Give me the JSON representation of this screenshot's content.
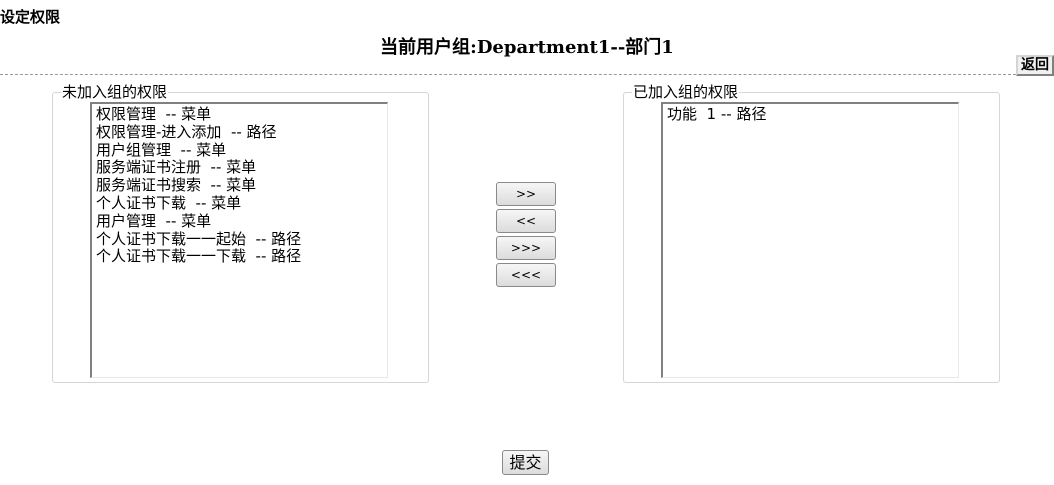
{
  "page": {
    "heading": "设定权限",
    "group_title": "当前用户组:Department1--部门1",
    "return_label": "返回"
  },
  "left_panel": {
    "legend": "未加入组的权限",
    "options": [
      "权限管理  -- 菜单",
      "权限管理-进入添加  -- 路径",
      "用户组管理  -- 菜单",
      "服务端证书注册  -- 菜单",
      "服务端证书搜索  -- 菜单",
      "个人证书下载  -- 菜单",
      "用户管理  -- 菜单",
      "个人证书下载一一起始  -- 路径",
      "个人证书下载一一下载  -- 路径"
    ]
  },
  "right_panel": {
    "legend": "已加入组的权限",
    "options": [
      "功能  1 -- 路径"
    ]
  },
  "move_buttons": {
    "add": ">>",
    "remove": "<<",
    "add_all": ">>>",
    "remove_all": "<<<"
  },
  "submit_label": "提交"
}
